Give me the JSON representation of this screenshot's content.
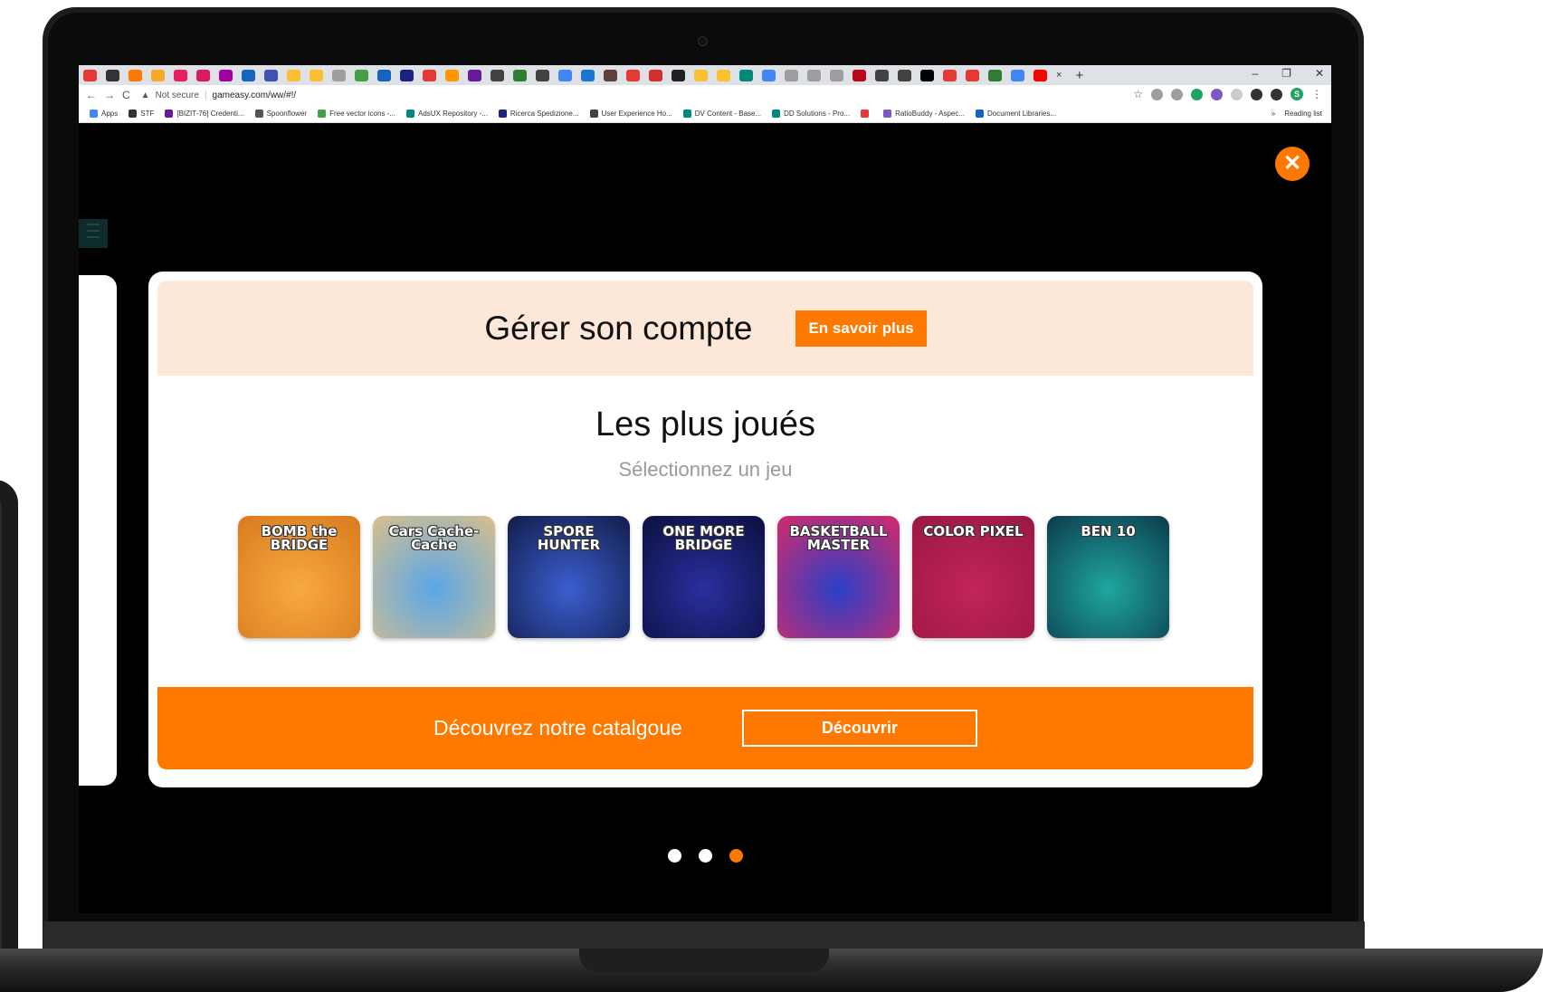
{
  "browser": {
    "tabs": {
      "favicon_colors": [
        "#e53935",
        "#333333",
        "#ff7900",
        "#f9a825",
        "#e91e63",
        "#d81b60",
        "#a100a1",
        "#1565c0",
        "#3f51b5",
        "#fbc02d",
        "#fbc02d",
        "#9e9e9e",
        "#43a047",
        "#1565c0",
        "#1a237e",
        "#e53935",
        "#ff9800",
        "#6a1b9a",
        "#424242",
        "#2e7d32",
        "#424242",
        "#4285f4",
        "#1976d2",
        "#5d4037",
        "#e53935",
        "#d32f2f",
        "#212121",
        "#fbc02d",
        "#fbc02d",
        "#00897b",
        "#4285f4",
        "#9e9e9e",
        "#9e9e9e",
        "#9e9e9e",
        "#bd081c",
        "#424242",
        "#424242",
        "#000000",
        "#e53935",
        "#e53935",
        "#2e7d32",
        "#4285f4",
        "#ff0000"
      ],
      "close_icon": "×",
      "new_tab_icon": "+"
    },
    "window_controls": {
      "minimize": "–",
      "restore": "❐",
      "close": "✕"
    },
    "nav": {
      "back": "←",
      "forward": "→",
      "reload": "C"
    },
    "address": {
      "security_icon": "▲",
      "security_label": "Not secure",
      "url": "gameasy.com/ww/#!/"
    },
    "extensions": {
      "star": "☆",
      "colors": [
        "#9e9e9e",
        "#9e9e9e",
        "#1ea362",
        "#7e57c2",
        "#cccccc",
        "#333333",
        "#333333"
      ],
      "profile_initial": "S",
      "profile_color": "#1ea362",
      "menu": "⋮"
    },
    "bookmarks": [
      {
        "label": "Apps",
        "color": "#4285f4"
      },
      {
        "label": "STF",
        "color": "#333333"
      },
      {
        "label": "[BIZIT-76] Credenti...",
        "color": "#6a1b9a"
      },
      {
        "label": "Spoonflower",
        "color": "#555555"
      },
      {
        "label": "Free vector icons -...",
        "color": "#43a047"
      },
      {
        "label": "AdsUX Repository -...",
        "color": "#00897b"
      },
      {
        "label": "Ricerca Spedizione...",
        "color": "#1a237e"
      },
      {
        "label": "User Experience Ho...",
        "color": "#424242"
      },
      {
        "label": "DV Content - Base...",
        "color": "#00897b"
      },
      {
        "label": "DD Solutions - Pro...",
        "color": "#00897b"
      },
      {
        "label": "",
        "color": "#e53935"
      },
      {
        "label": "RatioBuddy - Aspec...",
        "color": "#7e57c2"
      },
      {
        "label": "Document Libraries...",
        "color": "#1565c0"
      }
    ],
    "bookmarks_more": "»",
    "reading_list": "Reading list"
  },
  "page": {
    "close_icon": "✕",
    "card": {
      "account_title": "Gérer son compte",
      "account_button": "En savoir plus",
      "section_title": "Les plus joués",
      "section_subtitle": "Sélectionnez un jeu",
      "games": [
        {
          "title": "BOMB the BRIDGE",
          "bg1": "#f7a941",
          "bg2": "#d97a1e"
        },
        {
          "title": "Cars Cache-Cache",
          "bg1": "#5aa6e8",
          "bg2": "#d8c08c"
        },
        {
          "title": "SPORE HUNTER",
          "bg1": "#3a5fcf",
          "bg2": "#121c4a"
        },
        {
          "title": "ONE MORE BRIDGE",
          "bg1": "#2a2f9e",
          "bg2": "#0b0f3d"
        },
        {
          "title": "BASKETBALL MASTER",
          "bg1": "#2b3fc8",
          "bg2": "#d52a6a"
        },
        {
          "title": "COLOR PIXEL",
          "bg1": "#c2245a",
          "bg2": "#9a1745"
        },
        {
          "title": "BEN 10",
          "bg1": "#1fa6a0",
          "bg2": "#0b3b4a"
        }
      ],
      "catalog_text": "Découvrez notre catalgoue",
      "catalog_button": "Découvrir"
    },
    "carousel": {
      "count": 3,
      "active_index": 2
    }
  },
  "colors": {
    "accent": "#ff7900",
    "banner_light": "#fde7d8"
  }
}
